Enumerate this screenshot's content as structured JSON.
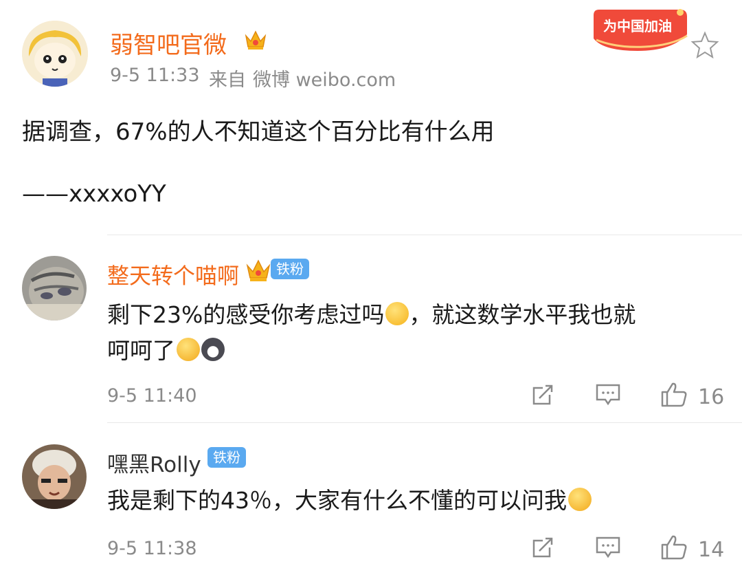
{
  "post": {
    "author": "弱智吧官微",
    "time": "9-5 11:33",
    "source_prefix": "来自",
    "source": "微博 weibo.com",
    "text_line1": "据调查，67%的人不知道这个百分比有什么用",
    "text_line2": "——xxxxoYY",
    "banner": "为中国加油"
  },
  "comments": [
    {
      "author": "整天转个喵啊",
      "badge": "铁粉",
      "text_a": "剩下23%的感受你考虑过吗",
      "text_b": "，就这数学水平我也就",
      "text_c": "呵呵了",
      "time": "9-5 11:40",
      "likes": "16"
    },
    {
      "author": "嘿黑Rolly",
      "badge": "铁粉",
      "text_a": "我是剩下的43％，大家有什么不懂的可以问我",
      "time": "9-5 11:38",
      "likes": "14"
    }
  ],
  "colors": {
    "accent": "#f36b1c",
    "fan_badge": "#5aa9f0",
    "banner": "#f04a3a"
  }
}
